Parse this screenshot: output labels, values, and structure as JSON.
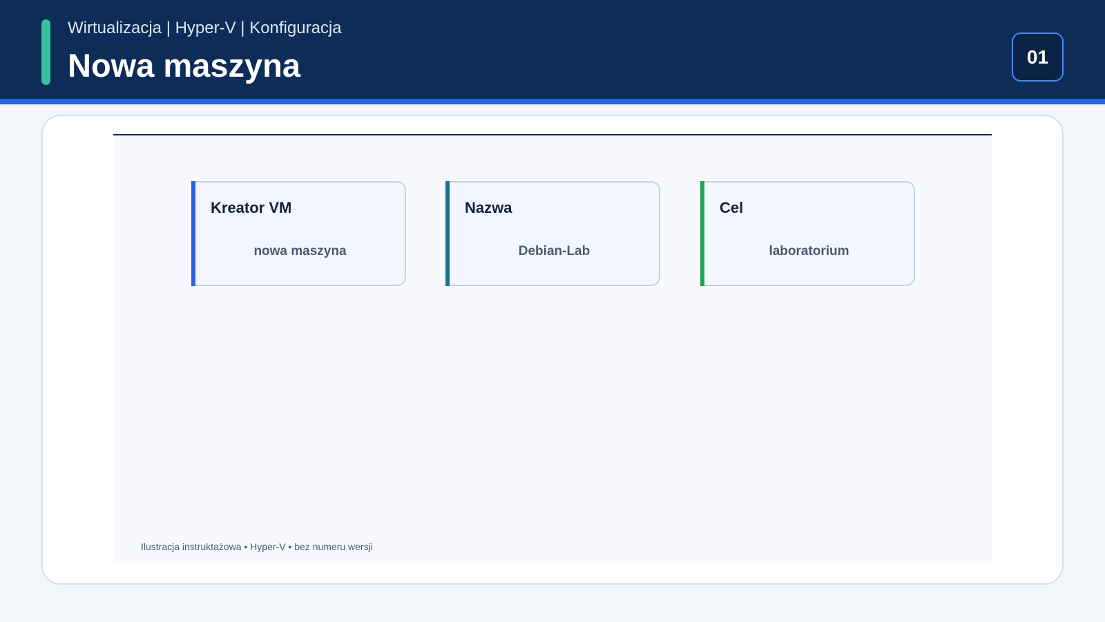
{
  "header": {
    "subtitle": "Wirtualizacja | Hyper-V | Konfiguracja",
    "title": "Nowa maszyna",
    "page_number": "01"
  },
  "cards": [
    {
      "label": "Kreator VM",
      "value": "nowa maszyna",
      "accent_color": "#2563e0"
    },
    {
      "label": "Nazwa",
      "value": "Debian-Lab",
      "accent_color": "#137a8f"
    },
    {
      "label": "Cel",
      "value": "laboratorium",
      "accent_color": "#1fa653"
    }
  ],
  "footnote": "Ilustracja instruktażowa • Hyper-V • bez numeru wersji",
  "colors": {
    "header_bg": "#0d2c57",
    "header_stripe": "#2563e0",
    "header_accent": "#35c2a0"
  }
}
